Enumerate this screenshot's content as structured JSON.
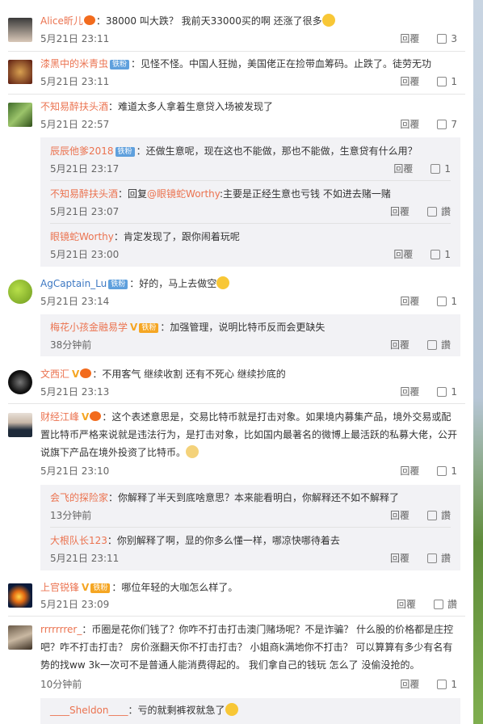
{
  "comments": [
    {
      "user": "Alice昕儿",
      "text": "：38000 叫大跌？ 我前天33000买的啊 还涨了很多",
      "time": "5月21日 23:11",
      "reply": "回覆",
      "likes": "3"
    },
    {
      "user": "漆黑中的米青虫",
      "badge": "铁粉",
      "text": "：见怪不怪。中国人狂抛，美国佬正在捡带血筹码。止跌了。徒劳无功",
      "time": "5月21日 23:11",
      "reply": "回覆",
      "likes": "1"
    },
    {
      "user": "不知易醉扶头酒",
      "text": "：难道太多人拿着生意贷入场被发现了",
      "time": "5月21日 22:57",
      "reply": "回覆",
      "likes": "7",
      "subs": [
        {
          "user": "辰辰他爹2018",
          "badge": "铁粉",
          "text": "：还做生意呢，现在这也不能做，那也不能做，生意贷有什么用？",
          "time": "5月21日 23:17",
          "reply": "回覆",
          "likes": "1"
        },
        {
          "user": "不知易醉扶头酒",
          "text": "：回复",
          "mention": "@眼镜蛇Worthy",
          "text2": ":主要是正经生意也亏钱 不如进去赌一赌",
          "time": "5月21日 23:07",
          "reply": "回覆",
          "likes": "讚"
        },
        {
          "user": "眼镜蛇Worthy",
          "text": "：肯定发现了，跟你闹着玩呢",
          "time": "5月21日 23:00",
          "reply": "回覆",
          "likes": "1"
        }
      ]
    },
    {
      "user": "AgCaptain_Lu",
      "badge": "铁粉",
      "text": "：好的，马上去做空",
      "time": "5月21日 23:14",
      "reply": "回覆",
      "likes": "1",
      "subs": [
        {
          "user": "梅花小孩金融易学",
          "vbadge": "V",
          "badge": "铁粉",
          "text": "：加强管理，说明比特币反而会更缺失",
          "time": "38分钟前",
          "reply": "回覆",
          "likes": "讚"
        }
      ]
    },
    {
      "user": "文西汇",
      "vbadge": "V",
      "text": "：不用客气 继续收割 还有不死心 继续抄底的",
      "time": "5月21日 23:13",
      "reply": "回覆",
      "likes": "1"
    },
    {
      "user": "财经江峰",
      "vbadge": "V",
      "text": "：这个表述意思是，交易比特币就是打击对象。如果境内募集产品，境外交易或配置比特币严格来说就是违法行为，是打击对象，比如国内最著名的微博上最活跃的私募大佬，公开说旗下产品在境外投资了比特币。",
      "time": "5月21日 23:10",
      "reply": "回覆",
      "likes": "1",
      "subs": [
        {
          "user": "会飞的探险家",
          "text": "：你解释了半天到底啥意思？本来能看明白，你解释还不如不解释了",
          "time": "13分钟前",
          "reply": "回覆",
          "likes": "讚"
        },
        {
          "user": "大根队长123",
          "text": "：你别解释了啊，显的你多么懂一样，哪凉快哪待着去",
          "time": "5月21日 23:11",
          "reply": "回覆",
          "likes": "讚"
        }
      ]
    },
    {
      "user": "上官锐锋",
      "vbadge": "V",
      "badge": "铁粉",
      "text": "：哪位年轻的大咖怎么样了。",
      "time": "5月21日 23:09",
      "reply": "回覆",
      "likes": "讚"
    },
    {
      "user": "rrrrrrrer_",
      "text": "：币圈是花你们钱了？你咋不打击打击澳门赌场呢？不是诈骗？ 什么股的价格都是庄控吧？咋不打击打击？ 房价涨翻天你不打击打击？ 小姐商k满地你不打击？ 可以算算有多少有名有势的找ww 3k一次可不是普通人能消费得起的。 我们拿自己的钱玩 怎么了 没偷没抢的。",
      "time": "10分钟前",
      "reply": "回覆",
      "likes": "1",
      "subs": [
        {
          "user": "____Sheldon____",
          "text": "：亏的就剩裤衩就急了"
        }
      ]
    }
  ]
}
